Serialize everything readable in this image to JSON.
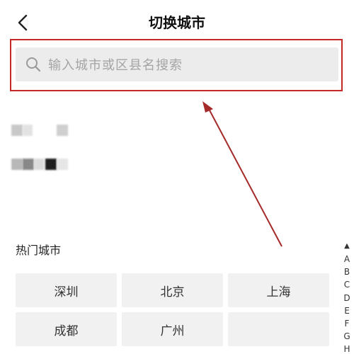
{
  "header": {
    "title": "切换城市",
    "back_icon": "chevron-left-icon"
  },
  "search": {
    "placeholder": "输入城市或区县名搜索",
    "icon": "search-icon",
    "highlight_color": "#c62828"
  },
  "annotation": {
    "arrow_color": "#a52a2a"
  },
  "hot_cities": {
    "title": "热门城市",
    "items": [
      "深圳",
      "北京",
      "上海",
      "成都",
      "广州",
      ""
    ]
  },
  "alpha_index": {
    "up_icon": "▲",
    "letters": [
      "A",
      "B",
      "C",
      "D",
      "E",
      "F",
      "G",
      "H"
    ]
  }
}
